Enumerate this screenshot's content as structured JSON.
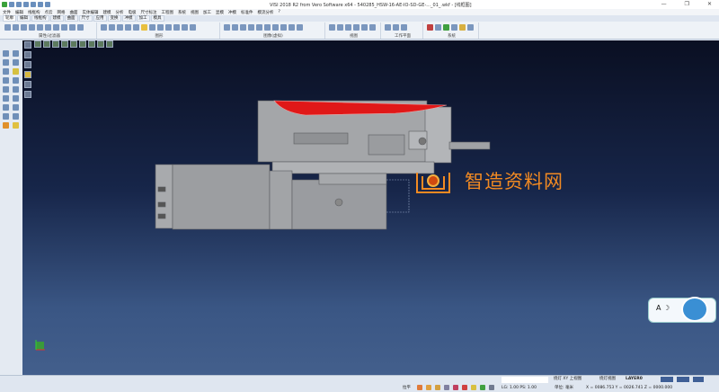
{
  "window": {
    "title": "VISI 2018 R2 from Vero Software x64 - 540285_HSW-16-AE-IO-SD-GE-..._01_.wkf - [线框图]",
    "min": "—",
    "max": "❐",
    "close": "✕"
  },
  "menu": [
    "文件",
    "编辑",
    "线框构",
    "点云",
    "网格",
    "曲面",
    "实体编辑",
    "建模",
    "分析",
    "电极",
    "尺寸标注",
    "工程图",
    "系统",
    "视图",
    "加工",
    "显模",
    "冲模",
    "标准件",
    "模流分析",
    "?"
  ],
  "tabs": [
    "轮廓",
    "编辑",
    "线框构",
    "建模",
    "曲面",
    "尺寸",
    "应用",
    "变换",
    "冲模",
    "加工",
    "模具"
  ],
  "ribbon_groups": [
    "属性/过滤器",
    "图形",
    "图像(虚拟)",
    "视图",
    "工作平面",
    "系统"
  ],
  "watermark": {
    "text": "智造资料网",
    "color": "#f28a22"
  },
  "mascot_text": "A ☽",
  "status": {
    "view_label": "绕灯 XY 上视图",
    "view_mode": "绕灯视图",
    "layer": "LAYER0",
    "mode": "拉平",
    "scale": "LG: 1.00 PS: 1.00",
    "units": "单位: 毫米",
    "coords": "X = 0086.753 Y = 0026.741 Z = 0000.000"
  },
  "colors": {
    "viewport_top": "#0a0f22",
    "viewport_bottom": "#435f8c",
    "model": "#9c9ea1",
    "highlight": "#e01818"
  }
}
